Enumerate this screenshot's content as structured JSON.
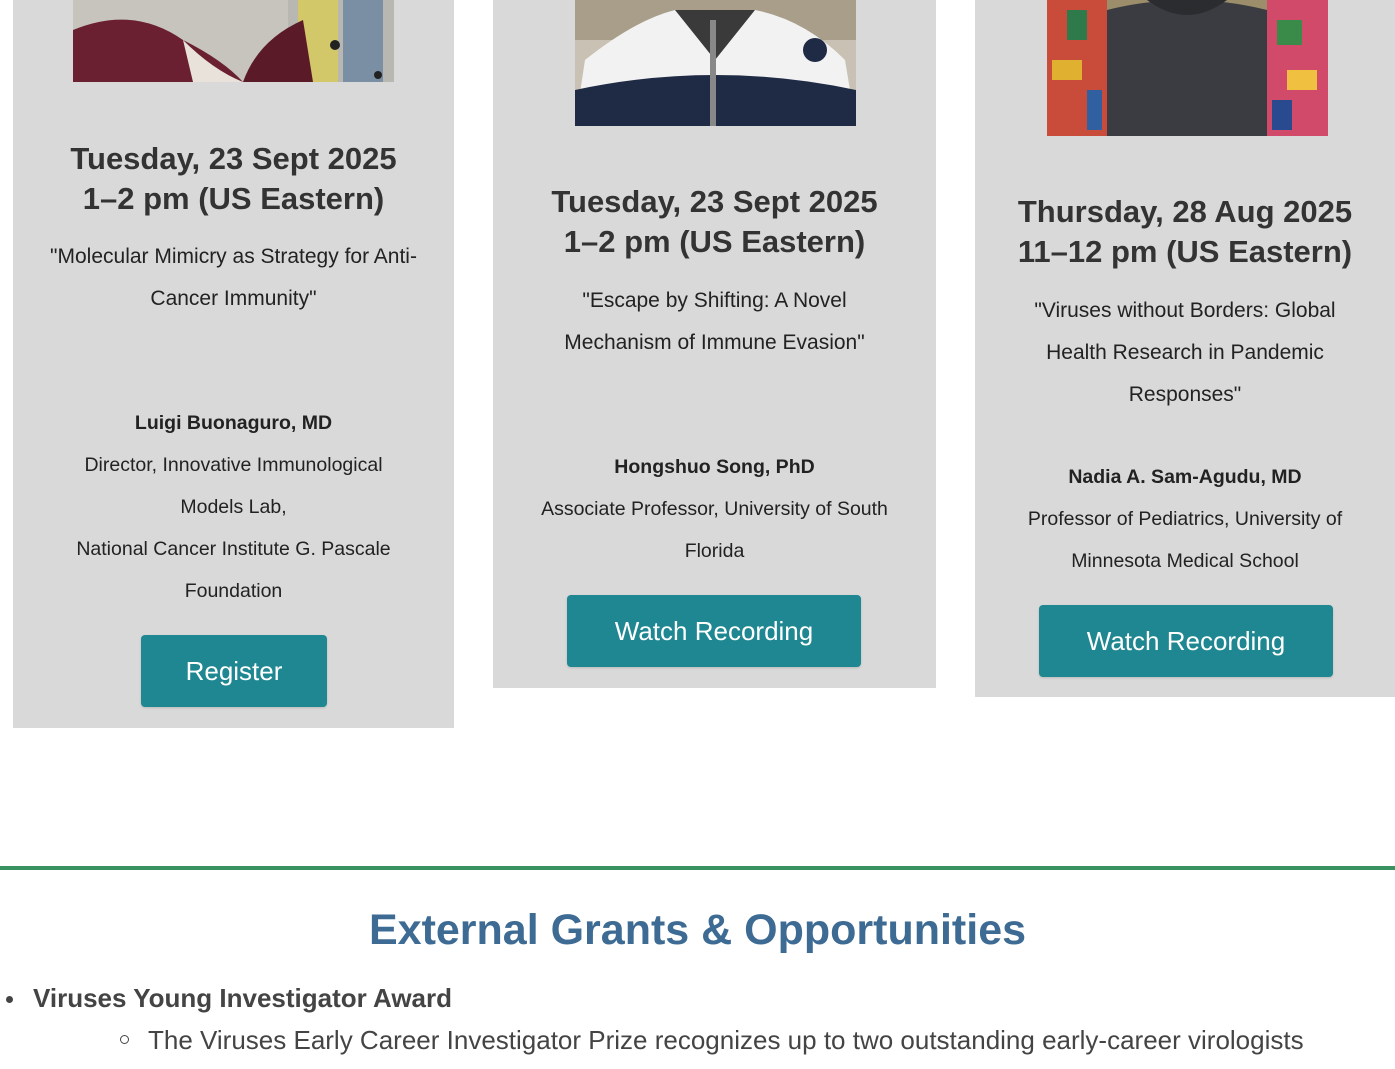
{
  "cards": [
    {
      "date": "Tuesday, 23 Sept 2025",
      "time": "1–2 pm (US Eastern)",
      "title": "\"Molecular Mimicry as Strategy for Anti-Cancer Immunity\"",
      "speaker_name": "Luigi Buonaguro, MD",
      "speaker_line1": "Director, Innovative Immunological Models Lab,",
      "speaker_line2": "National Cancer Institute G. Pascale Foundation",
      "button": "Register"
    },
    {
      "date": "Tuesday, 23 Sept 2025",
      "time": "1–2 pm (US Eastern)",
      "title": "\"Escape by Shifting: A Novel Mechanism of Immune Evasion\"",
      "speaker_name": "Hongshuo Song, PhD",
      "speaker_line1": "Associate Professor, University of South Florida",
      "button": "Watch Recording"
    },
    {
      "date": "Thursday, 28 Aug 2025",
      "time": "11–12 pm (US Eastern)",
      "title": "\"Viruses without Borders: Global Health Research in Pandemic Responses\"",
      "speaker_name": "Nadia A. Sam-Agudu, MD",
      "speaker_line1": "Professor of Pediatrics, University of Minnesota Medical School",
      "button": "Watch Recording"
    }
  ],
  "section": {
    "title": "External Grants & Opportunities",
    "items": [
      {
        "label": "Viruses Young Investigator Award",
        "subitems": [
          "The Viruses Early Career Investigator Prize recognizes up to two outstanding early-career virologists"
        ]
      }
    ]
  },
  "colors": {
    "card_bg": "#d9d9d9",
    "button": "#1e8791",
    "divider": "#3a9262",
    "section_title": "#3d6b93"
  }
}
